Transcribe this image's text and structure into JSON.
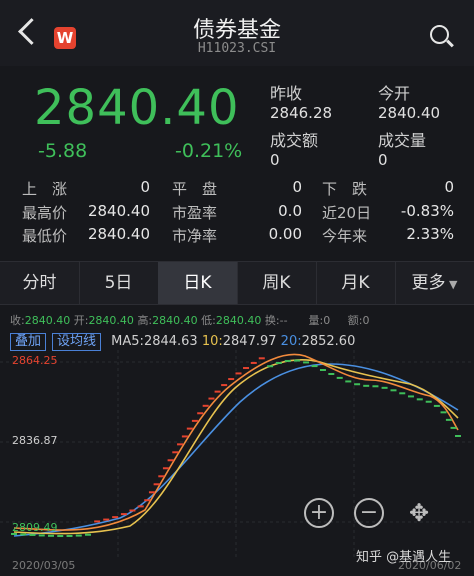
{
  "header": {
    "title": "债券基金",
    "code": "H11023.CSI",
    "logo_letter": "W"
  },
  "quote": {
    "price": "2840.40",
    "change": "-5.88",
    "change_pct": "-0.21%",
    "prev_close_label": "昨收",
    "prev_close": "2846.28",
    "open_label": "今开",
    "open": "2840.40",
    "turnover_label": "成交额",
    "turnover": "0",
    "volume_label": "成交量",
    "volume": "0"
  },
  "stats": {
    "up_label": "上　涨",
    "up": "0",
    "flat_label": "平　盘",
    "flat": "0",
    "down_label": "下　跌",
    "down": "0",
    "high_label": "最高价",
    "high": "2840.40",
    "pe_label": "市盈率",
    "pe": "0.0",
    "d20_label": "近20日",
    "d20": "-0.83%",
    "low_label": "最低价",
    "low": "2840.40",
    "pb_label": "市净率",
    "pb": "0.00",
    "ytd_label": "今年来",
    "ytd": "2.33%"
  },
  "tabs": [
    "分时",
    "5日",
    "日K",
    "周K",
    "月K",
    "更多"
  ],
  "active_tab": "日K",
  "info_line": {
    "close_label": "收:",
    "close": "2840.40",
    "open_label": "开:",
    "open": "2840.40",
    "high_label": "高:",
    "high": "2840.40",
    "low_label": "低:",
    "low": "2840.40",
    "chg_label": "换:",
    "chg": "--",
    "vol_label": "量:",
    "vol": "0",
    "amt_label": "额:",
    "amt": "0"
  },
  "ma_bar": {
    "overlay_btn": "叠加",
    "ma_btn": "设均线",
    "ma5_label": "MA5:",
    "ma5": "2844.63",
    "ma10_label": "10:",
    "ma10": "2847.97",
    "ma20_label": "20:",
    "ma20": "2852.60"
  },
  "chart_data": {
    "type": "line",
    "y_max": "2864.25",
    "y_mid": "2836.87",
    "y_min": "2809.49",
    "x_start": "2020/03/05",
    "x_end": "2020/06/02",
    "colors": {
      "up": "#e5432f",
      "down": "#3fbf5a",
      "ma5": "#f28a3c",
      "ma10": "#e7c24f",
      "ma20": "#4a90e2"
    }
  },
  "watermark": "知乎 @基遇人生"
}
